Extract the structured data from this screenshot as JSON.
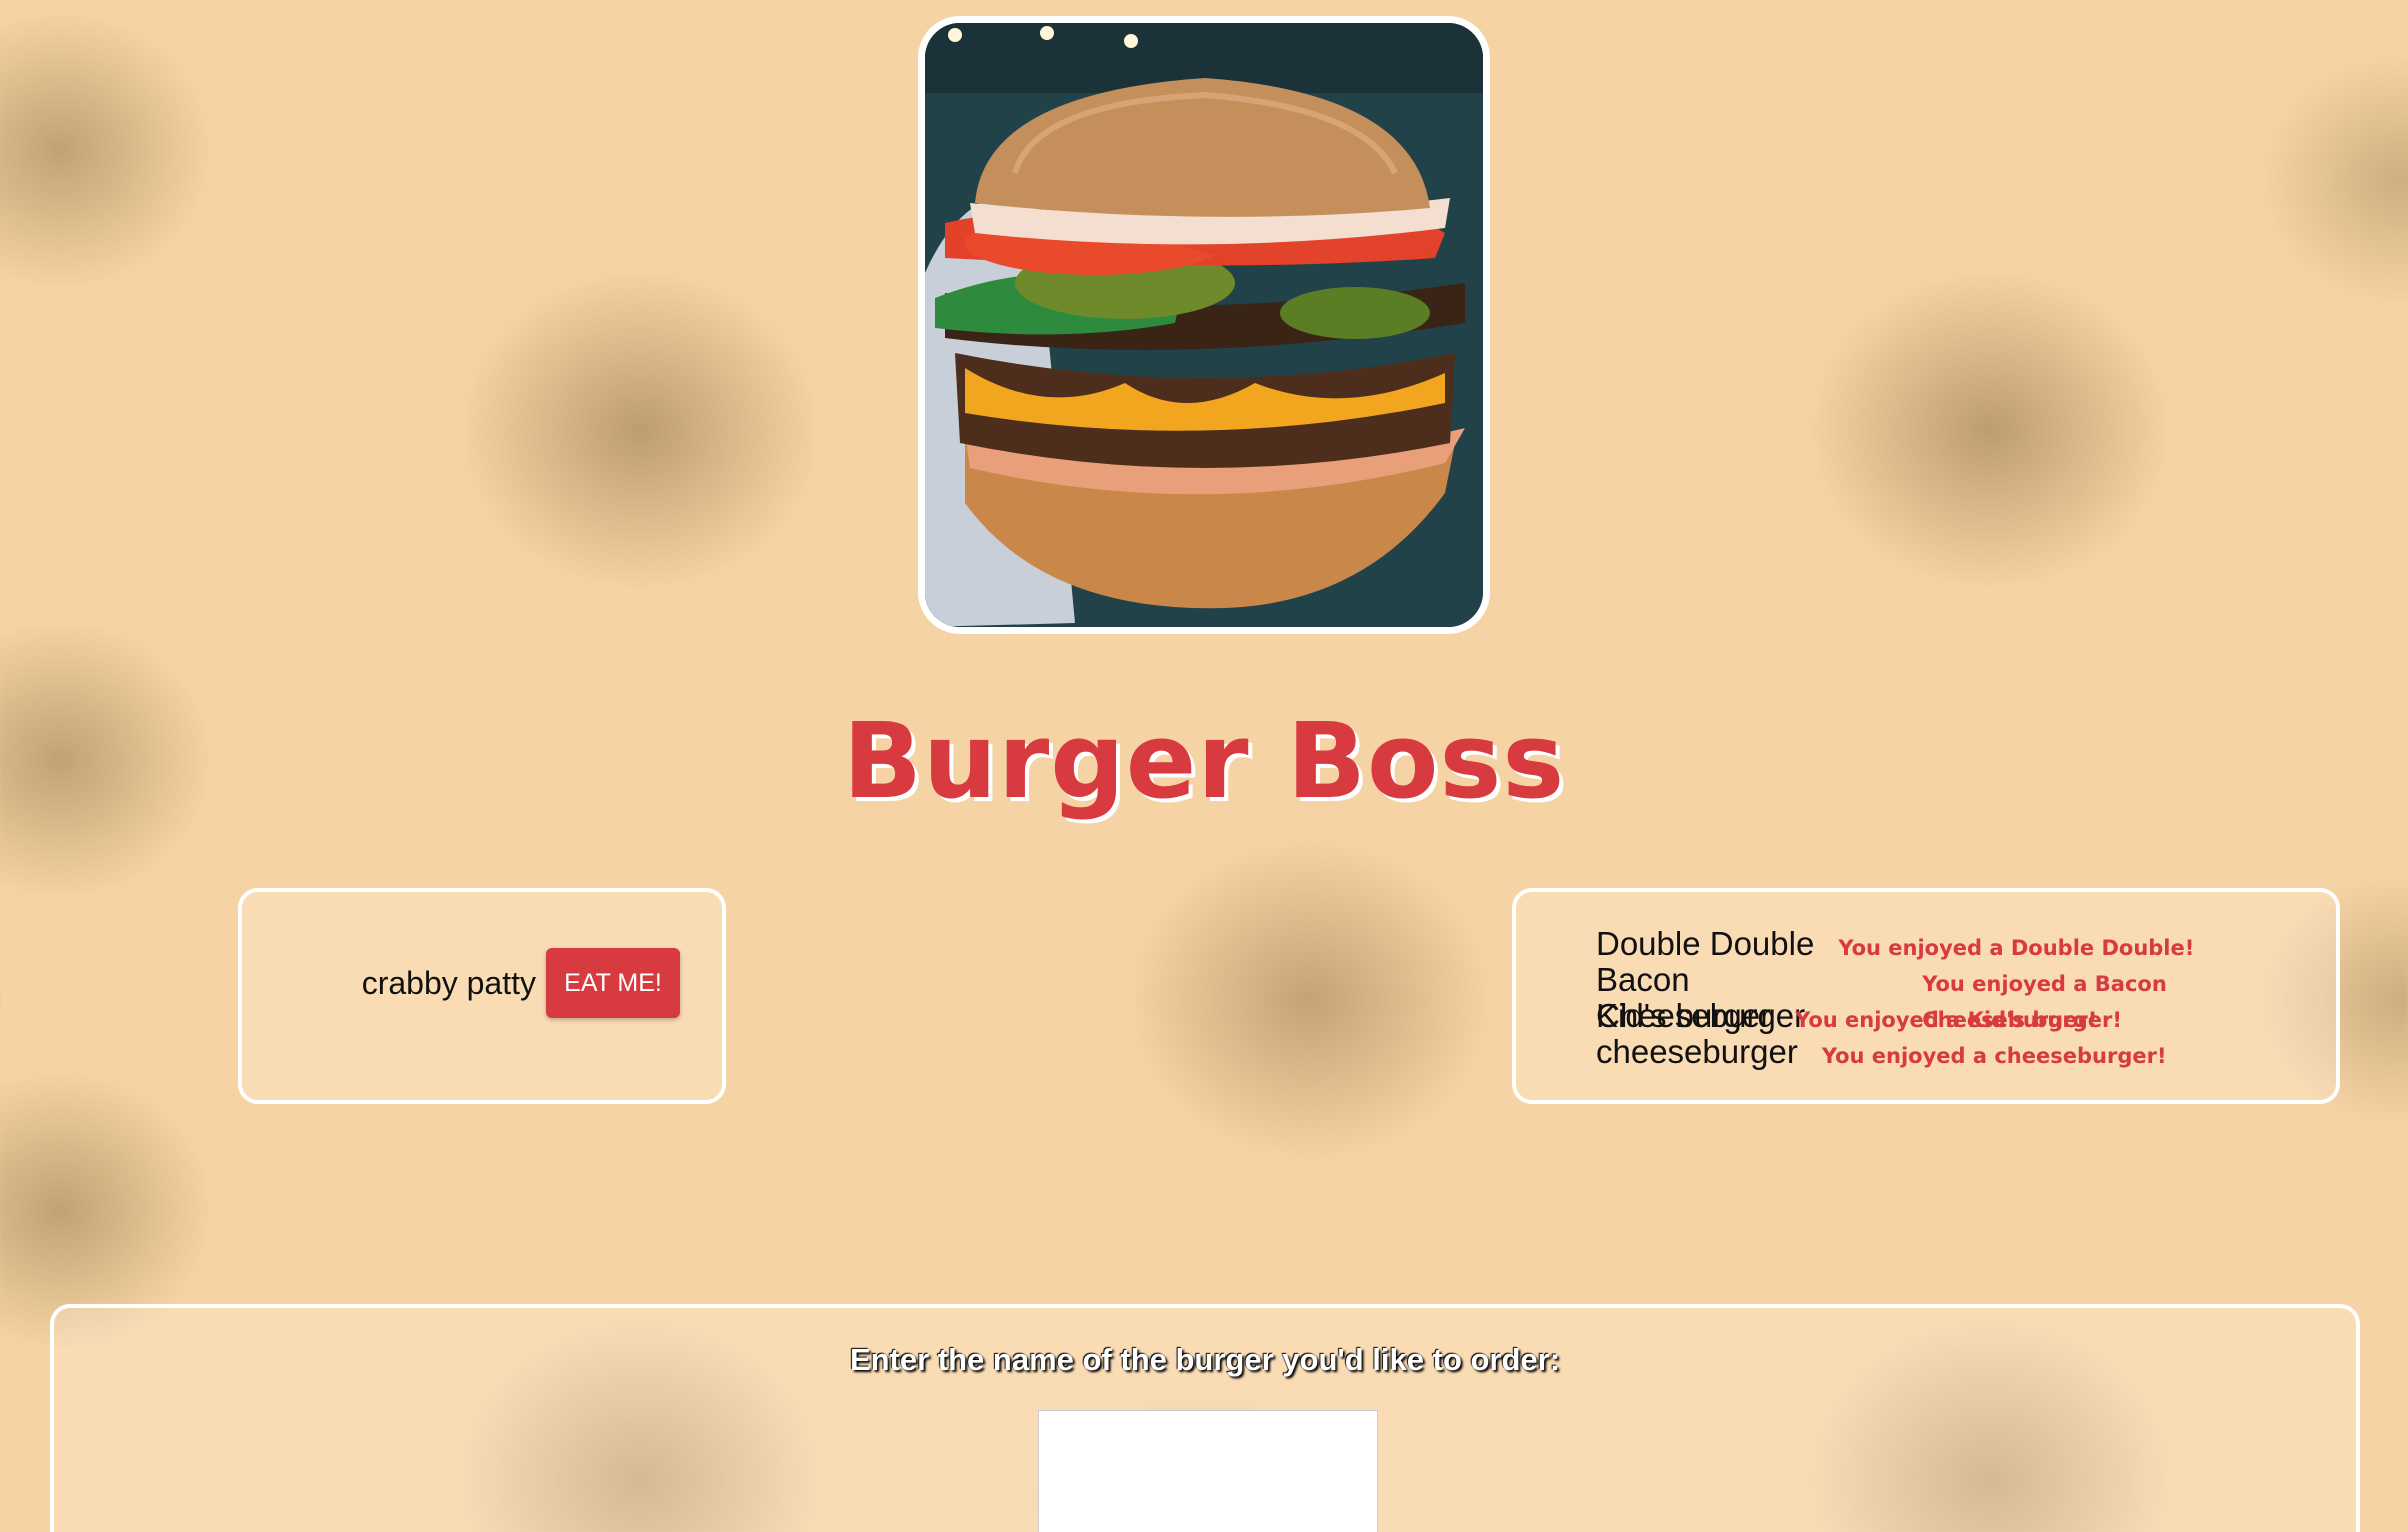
{
  "app": {
    "title": "Burger Boss"
  },
  "hero": {
    "image": "burger-photo"
  },
  "uneaten": {
    "items": [
      {
        "name": "crabby patty",
        "button_label": "EAT ME!"
      }
    ]
  },
  "eaten": {
    "items": [
      {
        "name": "Double Double",
        "message": "You enjoyed a Double Double!"
      },
      {
        "name": "Bacon Cheeseburger",
        "message": "You enjoyed a Bacon Cheeseburger!"
      },
      {
        "name": "Kid's burger",
        "message": "You enjoyed a Kid's burger!"
      },
      {
        "name": "cheeseburger",
        "message": "You enjoyed a cheeseburger!"
      }
    ]
  },
  "order_form": {
    "label": "Enter the name of the burger you'd like to order:",
    "input_value": ""
  },
  "colors": {
    "accent": "#d73a3f",
    "background": "#f6d3a4",
    "panel_border": "#ffffff"
  }
}
